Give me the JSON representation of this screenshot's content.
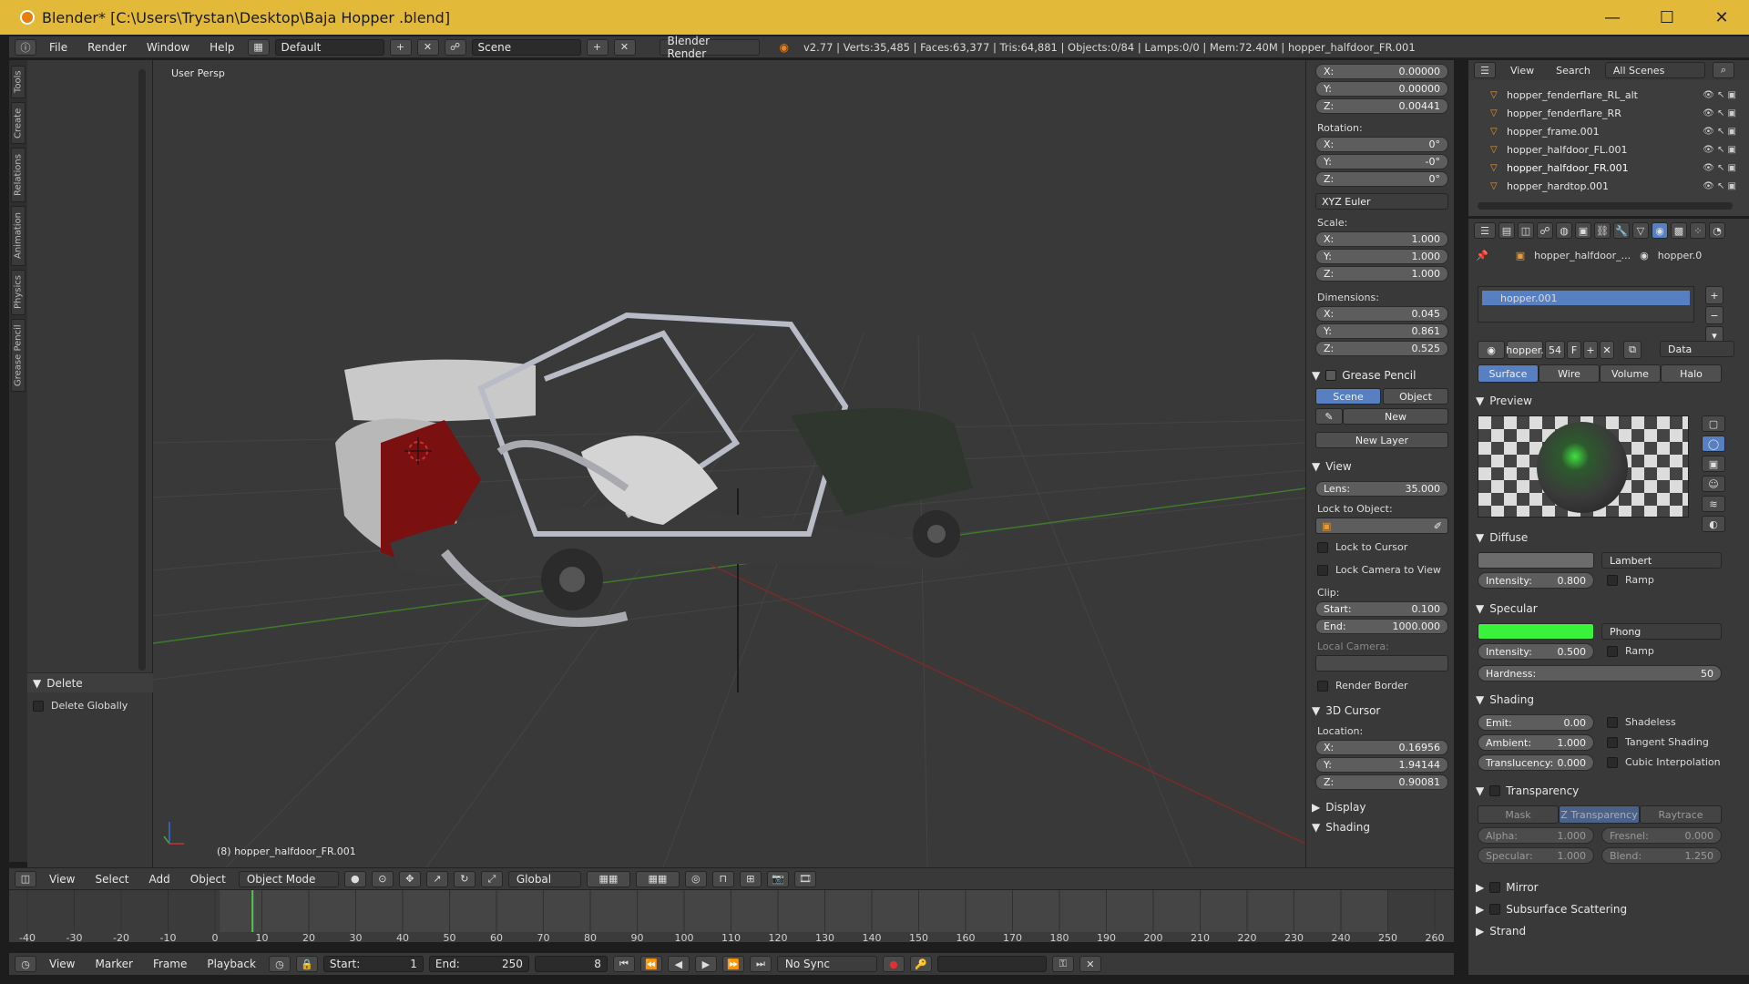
{
  "window": {
    "title": "Blender* [C:\\Users\\Trystan\\Desktop\\Baja Hopper .blend]",
    "minimize": "—",
    "maximize": "☐",
    "close": "✕"
  },
  "info_header": {
    "menus": [
      "File",
      "Render",
      "Window",
      "Help"
    ],
    "layout": "Default",
    "scene": "Scene",
    "engine": "Blender Render",
    "stats": "v2.77 | Verts:35,485 | Faces:63,377 | Tris:64,881 | Objects:0/84 | Lamps:0/0 | Mem:72.40M | hopper_halfdoor_FR.001"
  },
  "tool_tabs": [
    "Tools",
    "Create",
    "Relations",
    "Animation",
    "Physics",
    "Grease Pencil"
  ],
  "tool_shelf": {
    "operator_panel": "Delete",
    "delete_globally": "Delete Globally"
  },
  "viewport": {
    "persp_label": "User Persp",
    "object_label": "(8) hopper_halfdoor_FR.001"
  },
  "n_panel": {
    "location": {
      "x": "X:",
      "x_val": "0.00000",
      "y": "Y:",
      "y_val": "0.00000",
      "z": "Z:",
      "z_val": "0.00441"
    },
    "rotation_label": "Rotation:",
    "rotation": {
      "x": "X:",
      "x_val": "0°",
      "y": "Y:",
      "y_val": "-0°",
      "z": "Z:",
      "z_val": "0°"
    },
    "rotation_mode": "XYZ Euler",
    "scale_label": "Scale:",
    "scale": {
      "x": "X:",
      "x_val": "1.000",
      "y": "Y:",
      "y_val": "1.000",
      "z": "Z:",
      "z_val": "1.000"
    },
    "dimensions_label": "Dimensions:",
    "dimensions": {
      "x": "X:",
      "x_val": "0.045",
      "y": "Y:",
      "y_val": "0.861",
      "z": "Z:",
      "z_val": "0.525"
    },
    "grease_pencil": "Grease Pencil",
    "gp_scene": "Scene",
    "gp_object": "Object",
    "gp_new": "New",
    "gp_new_layer": "New Layer",
    "view_head": "View",
    "lens_label": "Lens:",
    "lens_val": "35.000",
    "lock_to_object": "Lock to Object:",
    "lock_to_cursor": "Lock to Cursor",
    "lock_camera": "Lock Camera to View",
    "clip_label": "Clip:",
    "clip_start_label": "Start:",
    "clip_start": "0.100",
    "clip_end_label": "End:",
    "clip_end": "1000.000",
    "local_camera": "Local Camera:",
    "render_border": "Render Border",
    "cursor_head": "3D Cursor",
    "cursor_location": "Location:",
    "cursor": {
      "x": "X:",
      "x_val": "0.16956",
      "y": "Y:",
      "y_val": "1.94144",
      "z": "Z:",
      "z_val": "0.90081"
    },
    "display_head": "Display",
    "shading_head": "Shading"
  },
  "outliner": {
    "view": "View",
    "search": "Search",
    "scenes": "All Scenes",
    "rows": [
      "hopper_fenderflare_RL_alt",
      "hopper_fenderflare_RR",
      "hopper_frame.001",
      "hopper_halfdoor_FL.001",
      "hopper_halfdoor_FR.001",
      "hopper_hardtop.001"
    ]
  },
  "properties": {
    "breadcrumb_object": "hopper_halfdoor_...",
    "breadcrumb_material": "hopper.0",
    "material_slot": "hopper.001",
    "material_name": "hopper.",
    "users": "54",
    "fake": "F",
    "link": "Data",
    "tabs": [
      "Surface",
      "Wire",
      "Volume",
      "Halo"
    ],
    "preview_head": "Preview",
    "diffuse_head": "Diffuse",
    "diffuse_shader": "Lambert",
    "diffuse_intensity_label": "Intensity:",
    "diffuse_intensity": "0.800",
    "ramp": "Ramp",
    "specular_head": "Specular",
    "specular_shader": "Phong",
    "specular_intensity_label": "Intensity:",
    "specular_intensity": "0.500",
    "hardness_label": "Hardness:",
    "hardness": "50",
    "shading_head": "Shading",
    "emit_label": "Emit:",
    "emit": "0.00",
    "ambient_label": "Ambient:",
    "ambient": "1.000",
    "translucency_label": "Translucency:",
    "translucency": "0.000",
    "shadeless": "Shadeless",
    "tangent_shading": "Tangent Shading",
    "cubic_interp": "Cubic Interpolation",
    "transparency_head": "Transparency",
    "transp_tabs": [
      "Mask",
      "Z Transparency",
      "Raytrace"
    ],
    "alpha_label": "Alpha:",
    "alpha": "1.000",
    "fresnel_label": "Fresnel:",
    "fresnel": "0.000",
    "spec_label": "Specular:",
    "spec": "1.000",
    "blend_label": "Blend:",
    "blend": "1.250",
    "mirror_head": "Mirror",
    "sss_head": "Subsurface Scattering",
    "strand_head": "Strand",
    "colors": {
      "diffuse": "#6c6c6c",
      "specular": "#39f23a"
    }
  },
  "viewport_header": {
    "menus": [
      "View",
      "Select",
      "Add",
      "Object"
    ],
    "mode": "Object Mode",
    "orientation": "Global"
  },
  "timeline": {
    "tick_labels": [
      "-40",
      "-30",
      "-20",
      "-10",
      "0",
      "10",
      "20",
      "30",
      "40",
      "50",
      "60",
      "70",
      "80",
      "90",
      "100",
      "110",
      "120",
      "130",
      "140",
      "150",
      "160",
      "170",
      "180",
      "190",
      "200",
      "210",
      "220",
      "230",
      "240",
      "250",
      "260"
    ],
    "current_frame_marker": 8,
    "menus": [
      "View",
      "Marker",
      "Frame",
      "Playback"
    ],
    "start_label": "Start:",
    "start": "1",
    "end_label": "End:",
    "end": "250",
    "current": "8",
    "sync": "No Sync"
  }
}
